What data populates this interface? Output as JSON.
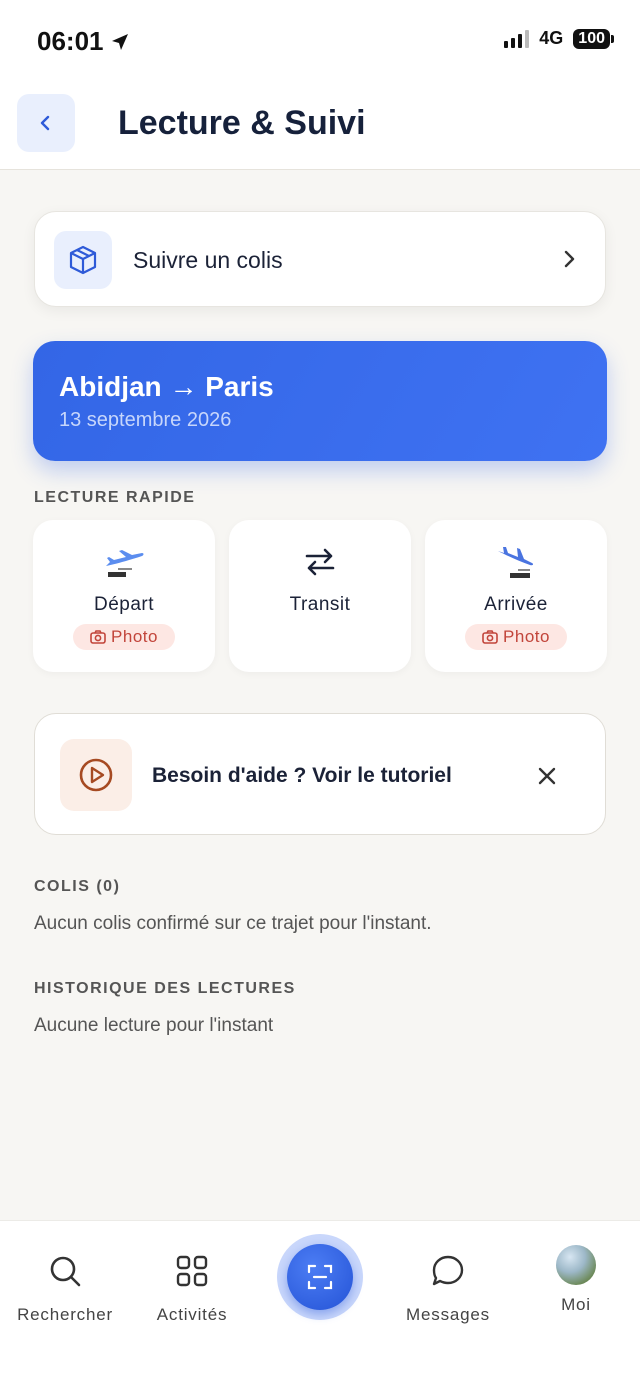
{
  "status_bar": {
    "time": "06:01",
    "network": "4G",
    "battery": "100"
  },
  "header": {
    "title": "Lecture & Suivi"
  },
  "track": {
    "label": "Suivre un colis"
  },
  "route": {
    "title": "Abidjan → Paris",
    "date": "13 septembre 2026"
  },
  "quick_read": {
    "label": "LECTURE RAPIDE",
    "items": [
      {
        "label": "Départ",
        "badge": "Photo",
        "icon": "plane-departure-icon"
      },
      {
        "label": "Transit",
        "icon": "transfer-arrows-icon"
      },
      {
        "label": "Arrivée",
        "badge": "Photo",
        "icon": "plane-arrival-icon"
      }
    ]
  },
  "help": {
    "text": "Besoin d'aide ? Voir le tutoriel"
  },
  "colis": {
    "label": "COLIS (0)",
    "empty": "Aucun colis confirmé sur ce trajet pour l'instant."
  },
  "history": {
    "label": "HISTORIQUE DES LECTURES",
    "empty": "Aucune lecture pour l'instant"
  },
  "nav": {
    "search": "Rechercher",
    "activities": "Activités",
    "messages": "Messages",
    "me": "Moi"
  },
  "colors": {
    "accent": "#3366e6",
    "badge_bg": "#fde7e3",
    "badge_text": "#c2453b"
  }
}
